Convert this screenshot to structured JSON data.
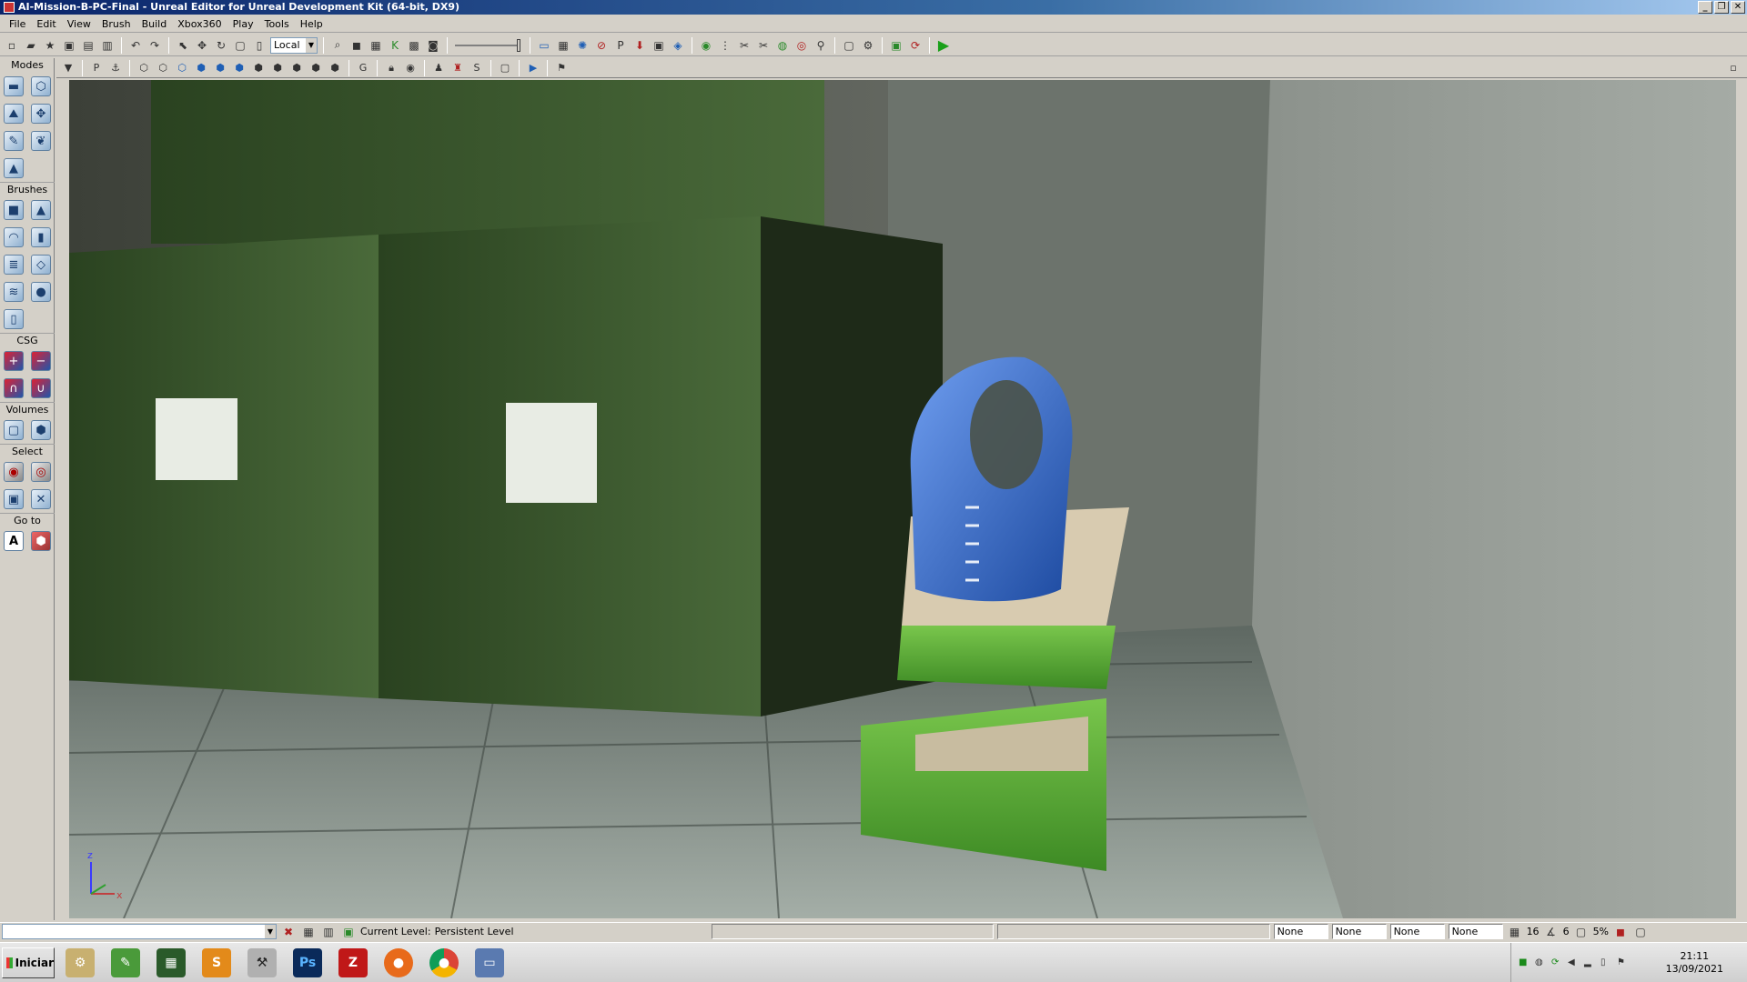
{
  "window": {
    "title": "AI-Mission-B-PC-Final - Unreal Editor for Unreal Development Kit (64-bit, DX9)",
    "controls": [
      "_",
      "❐",
      "✕"
    ]
  },
  "menu": [
    "File",
    "Edit",
    "View",
    "Brush",
    "Build",
    "Xbox360",
    "Play",
    "Tools",
    "Help"
  ],
  "toolbar": {
    "coord_system": "Local"
  },
  "modes_panel": {
    "title": "Modes",
    "sections": {
      "brushes": "Brushes",
      "csg": "CSG",
      "volumes": "Volumes",
      "select": "Select",
      "goto": "Go to"
    }
  },
  "viewport": {
    "axis_x": "x",
    "axis_z": "z",
    "colors": {
      "crate": "#3a5a2c",
      "vest": "#2f63c2",
      "case": "#5fb23a",
      "floor": "#8f9c93"
    }
  },
  "status_bar": {
    "current_level_label": "Current Level:",
    "current_level_value": "Persistent Level",
    "fields": [
      "None",
      "None",
      "None",
      "None"
    ],
    "grid_value": "16",
    "rotation_value": "6",
    "scale_value": "5%"
  },
  "taskbar": {
    "start_label": "Iniciar",
    "apps": [
      "utility-icon",
      "notepad-icon",
      "explorer-icon",
      "sublime-icon",
      "udk-icon",
      "photoshop-icon",
      "filezilla-icon",
      "firefox-icon",
      "chrome-icon",
      "remote-desktop-icon"
    ],
    "photoshop_label": "Ps",
    "clock_time": "21:11",
    "clock_date": "13/09/2021"
  }
}
